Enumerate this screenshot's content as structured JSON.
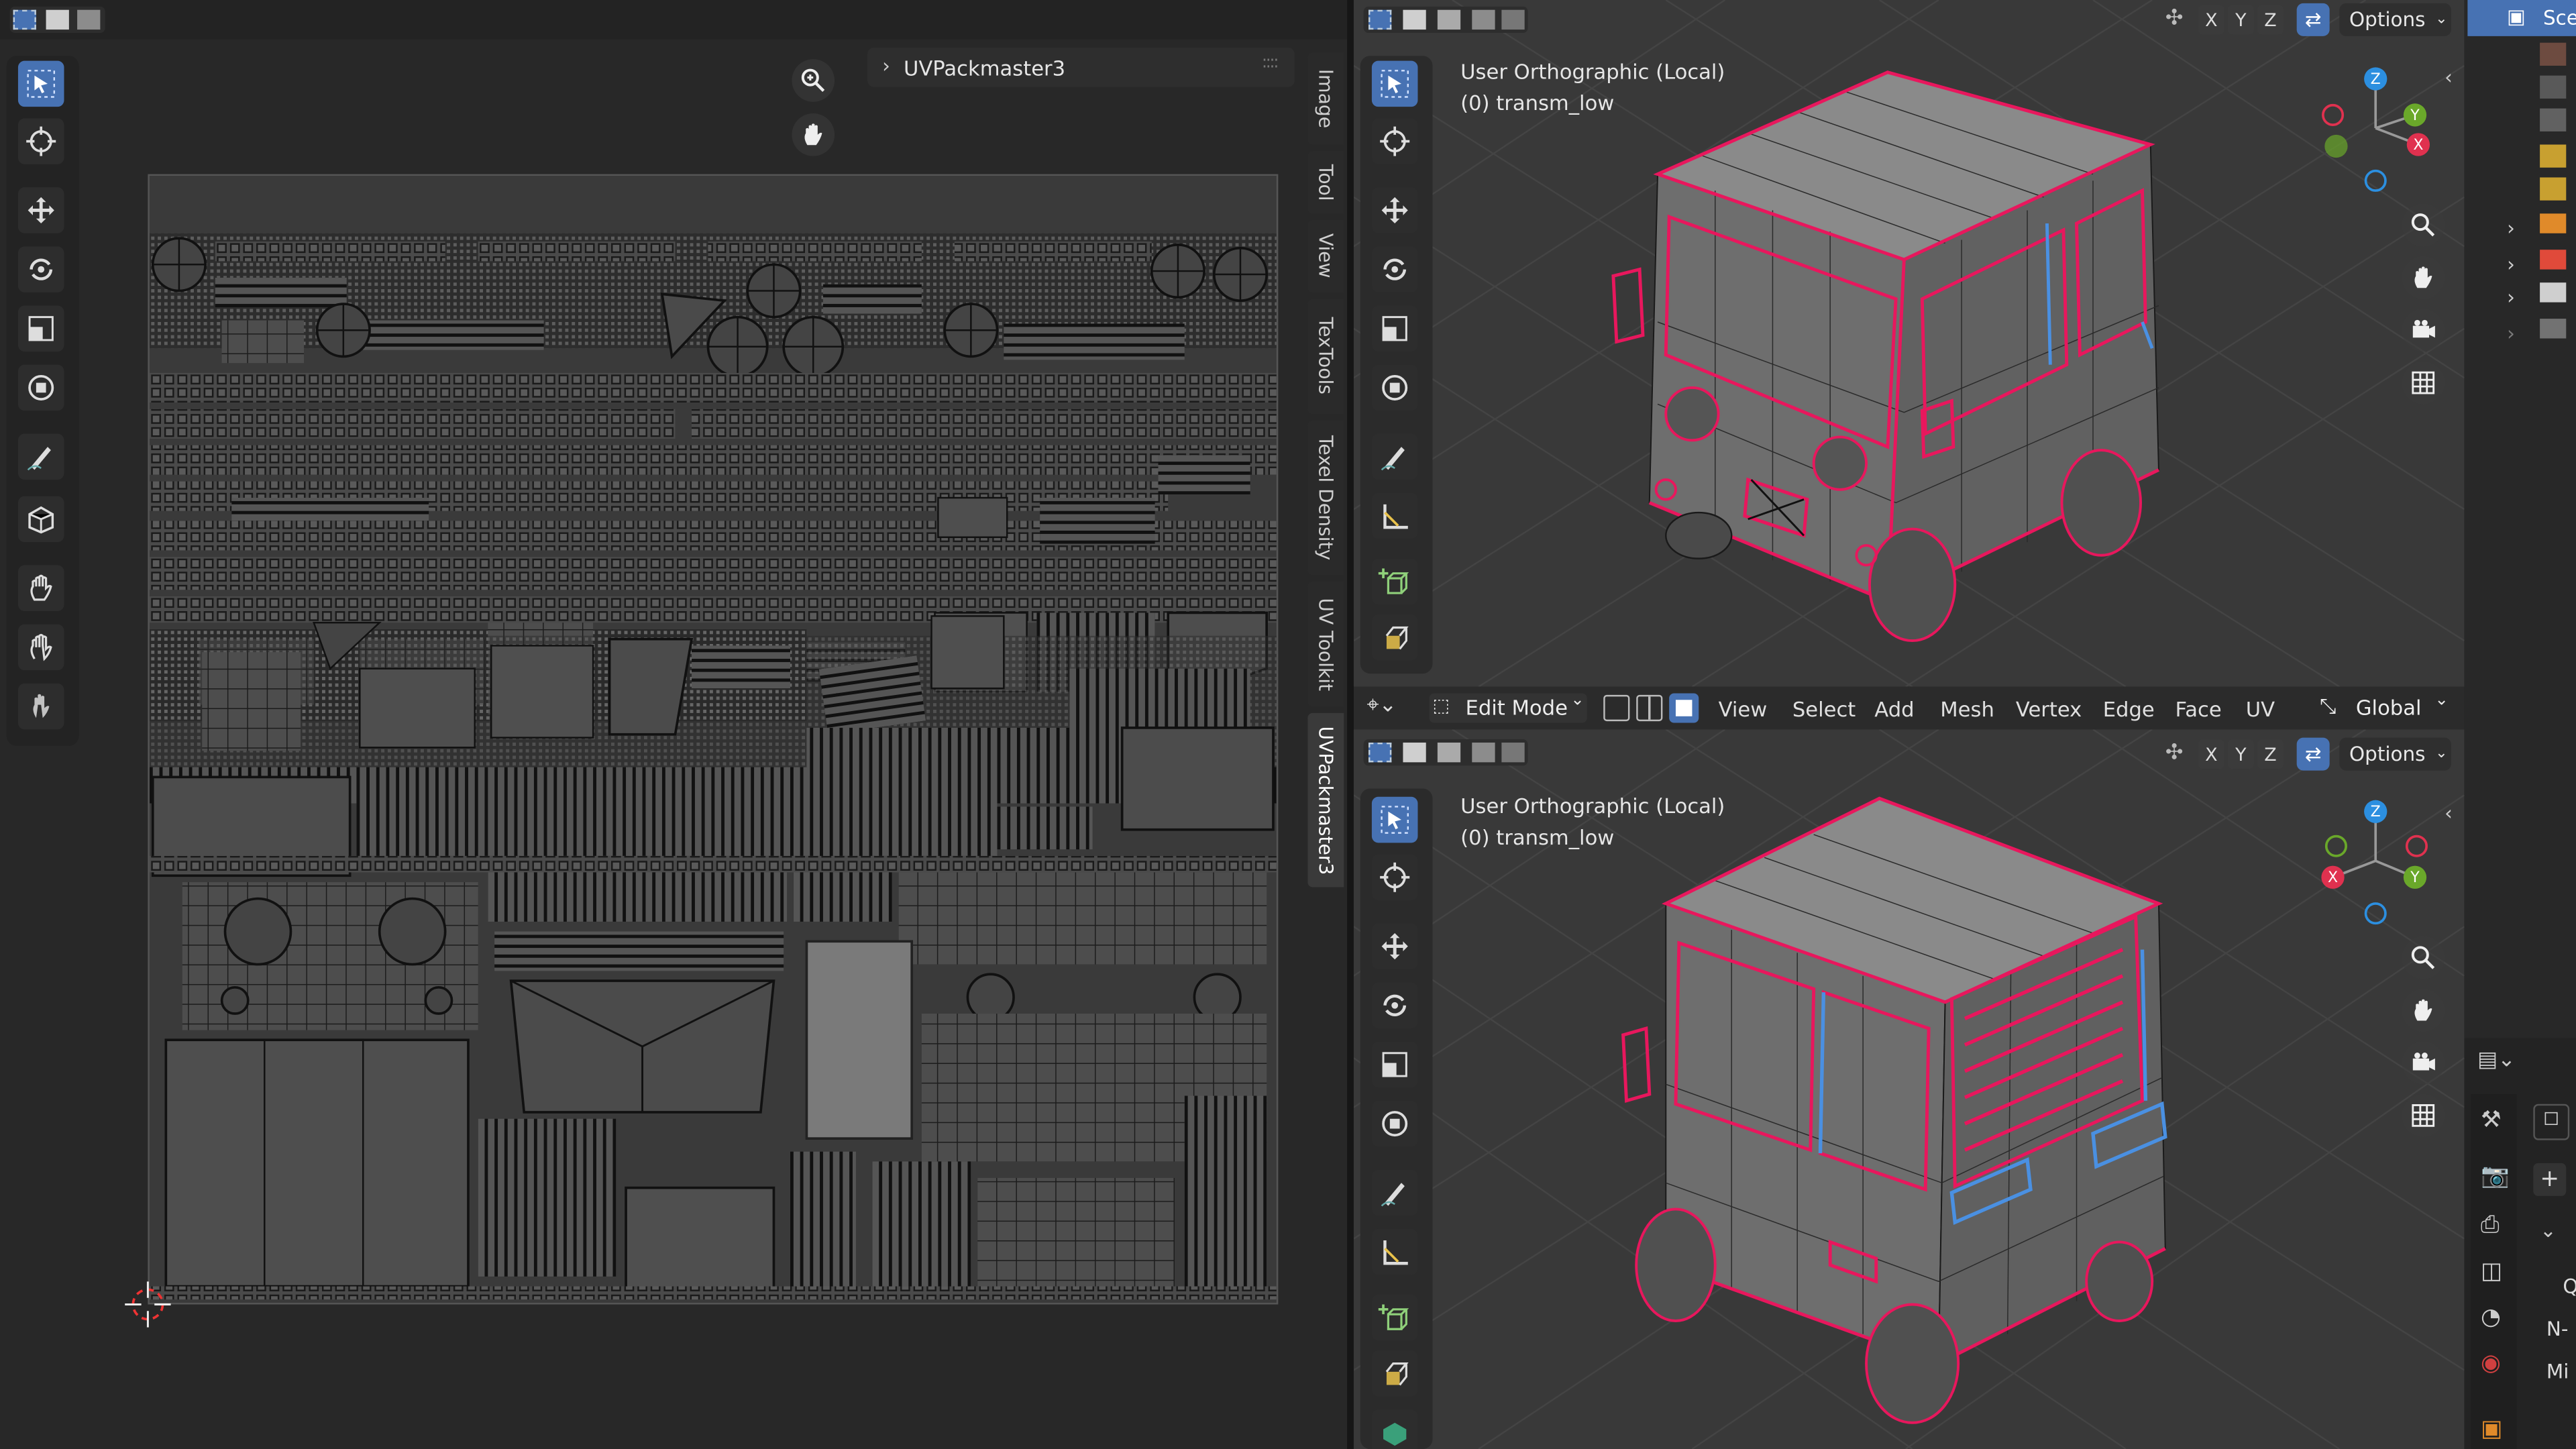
{
  "uv_editor": {
    "panel_title": "UVPackmaster3",
    "sidebar_tabs": [
      "Image",
      "Tool",
      "View",
      "TexTools",
      "Texel Density",
      "UV Toolkit",
      "UVPackmaster3"
    ]
  },
  "viewport_top": {
    "view_name": "User Orthographic (Local)",
    "object_name": "(0) transm_low",
    "axis_x": "X",
    "axis_y": "Y",
    "axis_z": "Z",
    "options_label": "Options"
  },
  "viewport_bottom": {
    "view_name": "User Orthographic (Local)",
    "object_name": "(0) transm_low",
    "axis_x": "X",
    "axis_y": "Y",
    "axis_z": "Z",
    "options_label": "Options"
  },
  "edit_header": {
    "mode_label": "Edit Mode",
    "menus": [
      "View",
      "Select",
      "Add",
      "Mesh",
      "Vertex",
      "Edge",
      "Face",
      "UV"
    ],
    "transform_orientation": "Global"
  },
  "gizmo_labels": {
    "x": "X",
    "y": "Y",
    "z": "Z"
  },
  "outliner": {
    "scene_label": "Sce"
  },
  "properties": {
    "labels": [
      "Q",
      "N-",
      "Mi"
    ]
  },
  "colors": {
    "accent": "#4772b3",
    "selected_edge": "#e8175d",
    "seam_edge": "#4a90e2",
    "axis_x": "#e0314f",
    "axis_y": "#6aa82a",
    "axis_z": "#2c8fe0"
  }
}
